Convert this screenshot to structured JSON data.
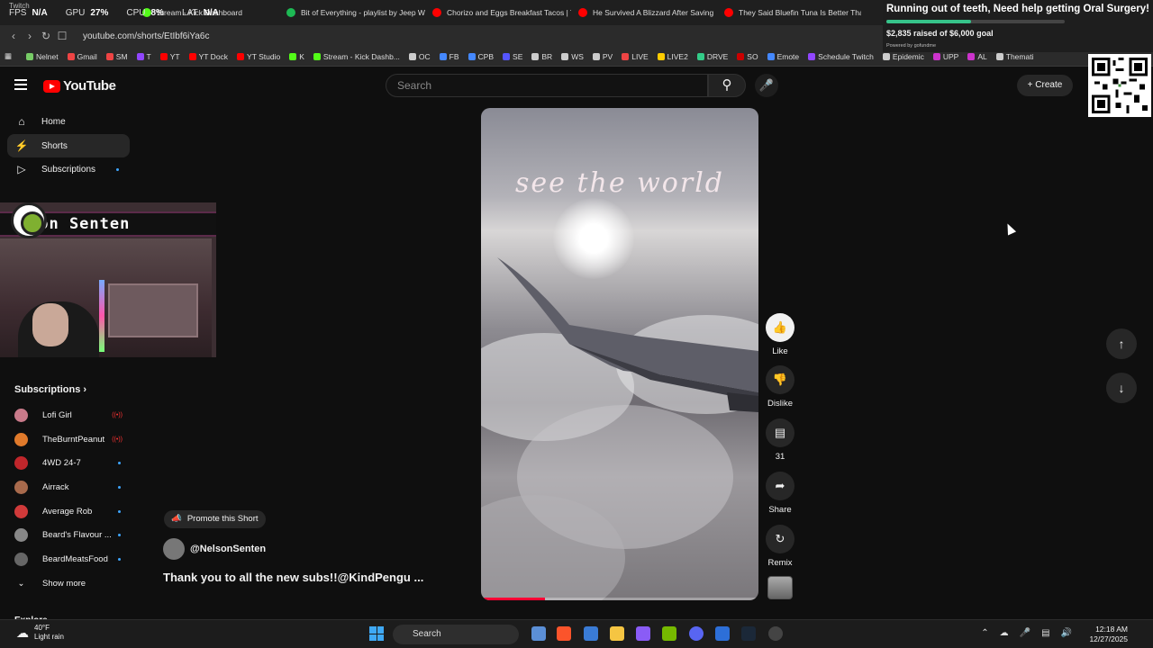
{
  "stats": {
    "fps_k": "FPS",
    "fps": "N/A",
    "gpu_k": "GPU",
    "gpu": "27%",
    "cpu_k": "CPU",
    "cpu": "8%",
    "lat_k": "LAT",
    "lat": "N/A"
  },
  "tabs": [
    {
      "label": "Twitch",
      "color": "#9146ff"
    },
    {
      "label": "Stream - Kick Dashboard",
      "color": "#53fc18"
    },
    {
      "label": "Bit of Everything - playlist by Jeep W",
      "color": "#1db954"
    },
    {
      "label": "Chorizo and Eggs Breakfast Tacos | T",
      "color": "#ff0000"
    },
    {
      "label": "He Survived A Blizzard After Saving",
      "color": "#ff0000"
    },
    {
      "label": "They Said Bluefin Tuna Is Better Than",
      "color": "#ff0000"
    }
  ],
  "address": {
    "url": "youtube.com/shorts/EtIbf6iYa6c"
  },
  "bookmarks": [
    "Nelnet",
    "Gmail",
    "SM",
    "T",
    "YT",
    "YT Dock",
    "YT Studio",
    "K",
    "Stream - Kick Dashb...",
    "OC",
    "FB",
    "CPB",
    "SE",
    "BR",
    "WS",
    "PV",
    "LIVE",
    "LIVE2",
    "DRVE",
    "SO",
    "Emote",
    "Schedule Twitch",
    "Epidemic",
    "UPP",
    "AL",
    "Themati"
  ],
  "header": {
    "logo": "YouTube",
    "search_placeholder": "Search",
    "create": "Create"
  },
  "sidebar": {
    "items": [
      {
        "label": "Home"
      },
      {
        "label": "Shorts"
      },
      {
        "label": "Subscriptions"
      }
    ],
    "subscriptions_title": "Subscriptions",
    "subs": [
      {
        "name": "Lofi Girl",
        "status": "live",
        "color": "#c97a8a"
      },
      {
        "name": "TheBurntPeanut",
        "status": "live",
        "color": "#e07a2b"
      },
      {
        "name": "4WD 24-7",
        "status": "dot",
        "color": "#c0262b"
      },
      {
        "name": "Airrack",
        "status": "dot",
        "color": "#a86a4c"
      },
      {
        "name": "Average Rob",
        "status": "dot",
        "color": "#d03a3a"
      },
      {
        "name": "Beard's Flavour ...",
        "status": "dot",
        "color": "#888888"
      },
      {
        "name": "BeardMeatsFood",
        "status": "dot",
        "color": "#666666"
      }
    ],
    "show_more": "Show more",
    "explore": "Explore"
  },
  "webcam": {
    "name": "son Senten"
  },
  "video": {
    "overlay_text": "see the world",
    "progress": 0.23
  },
  "actions": {
    "like": "Like",
    "dislike": "Dislike",
    "comments": "31",
    "share": "Share",
    "remix": "Remix"
  },
  "short_info": {
    "promote": "Promote this Short",
    "channel": "@NelsonSenten",
    "title": "Thank you to all the new subs!!@KindPengu ..."
  },
  "gofundme": {
    "title": "Running out of teeth, Need help getting Oral Surgery!",
    "raised": "$2,835 raised of $6,000 goal",
    "powered": "Powered by gofundme",
    "fraction": 0.4725
  },
  "taskbar": {
    "temp": "40°F",
    "weather": "Light rain",
    "search": "Search",
    "time": "12:18 AM",
    "date": "12/27/2025"
  }
}
